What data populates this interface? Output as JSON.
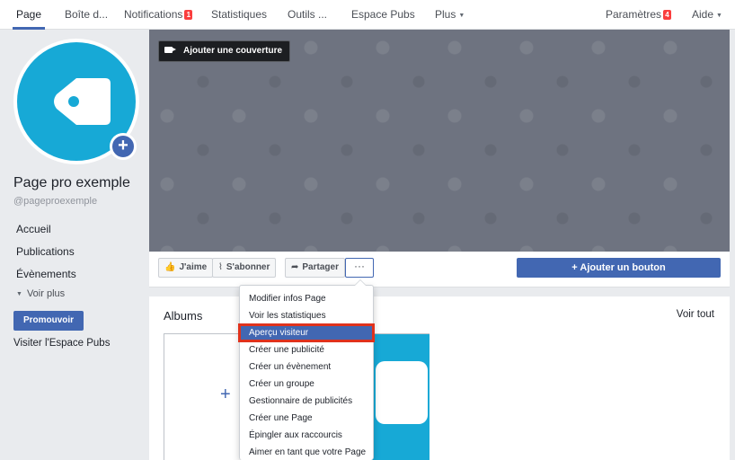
{
  "topnav": {
    "tabs": [
      {
        "label": "Page"
      },
      {
        "label": "Boîte d..."
      },
      {
        "label": "Notifications",
        "badge": "1"
      },
      {
        "label": "Statistiques"
      },
      {
        "label": "Outils ..."
      },
      {
        "label": "Espace Pubs"
      },
      {
        "label": "Plus"
      }
    ],
    "settings": {
      "label": "Paramètres",
      "badge": "4"
    },
    "help": {
      "label": "Aide"
    }
  },
  "profile": {
    "name": "Page pro exemple",
    "handle": "@pageproexemple"
  },
  "leftnav": {
    "items": [
      "Accueil",
      "Publications",
      "Évènements"
    ],
    "more": "Voir plus",
    "promote": "Promouvoir",
    "visit": "Visiter l'Espace Pubs"
  },
  "cover": {
    "add_cover": "Ajouter une couverture",
    "color": "#6e7380"
  },
  "actions": {
    "like": "J'aime",
    "follow": "S'abonner",
    "share": "Partager",
    "more": "···",
    "add_button": "+ Ajouter un bouton"
  },
  "albums": {
    "title": "Albums",
    "see_all": "Voir tout"
  },
  "dropdown": {
    "items": [
      "Modifier infos Page",
      "Voir les statistiques",
      "Aperçu visiteur",
      "Créer une publicité",
      "Créer un évènement",
      "Créer un groupe",
      "Gestionnaire de publicités",
      "Créer une Page",
      "Épingler aux raccourcis",
      "Aimer en tant que votre Page"
    ],
    "highlighted_index": 2
  },
  "colors": {
    "brand_blue": "#4267b2",
    "avatar_cyan": "#17a9d6",
    "badge_red": "#fa3e3e",
    "highlight_outline": "#e0321c"
  }
}
